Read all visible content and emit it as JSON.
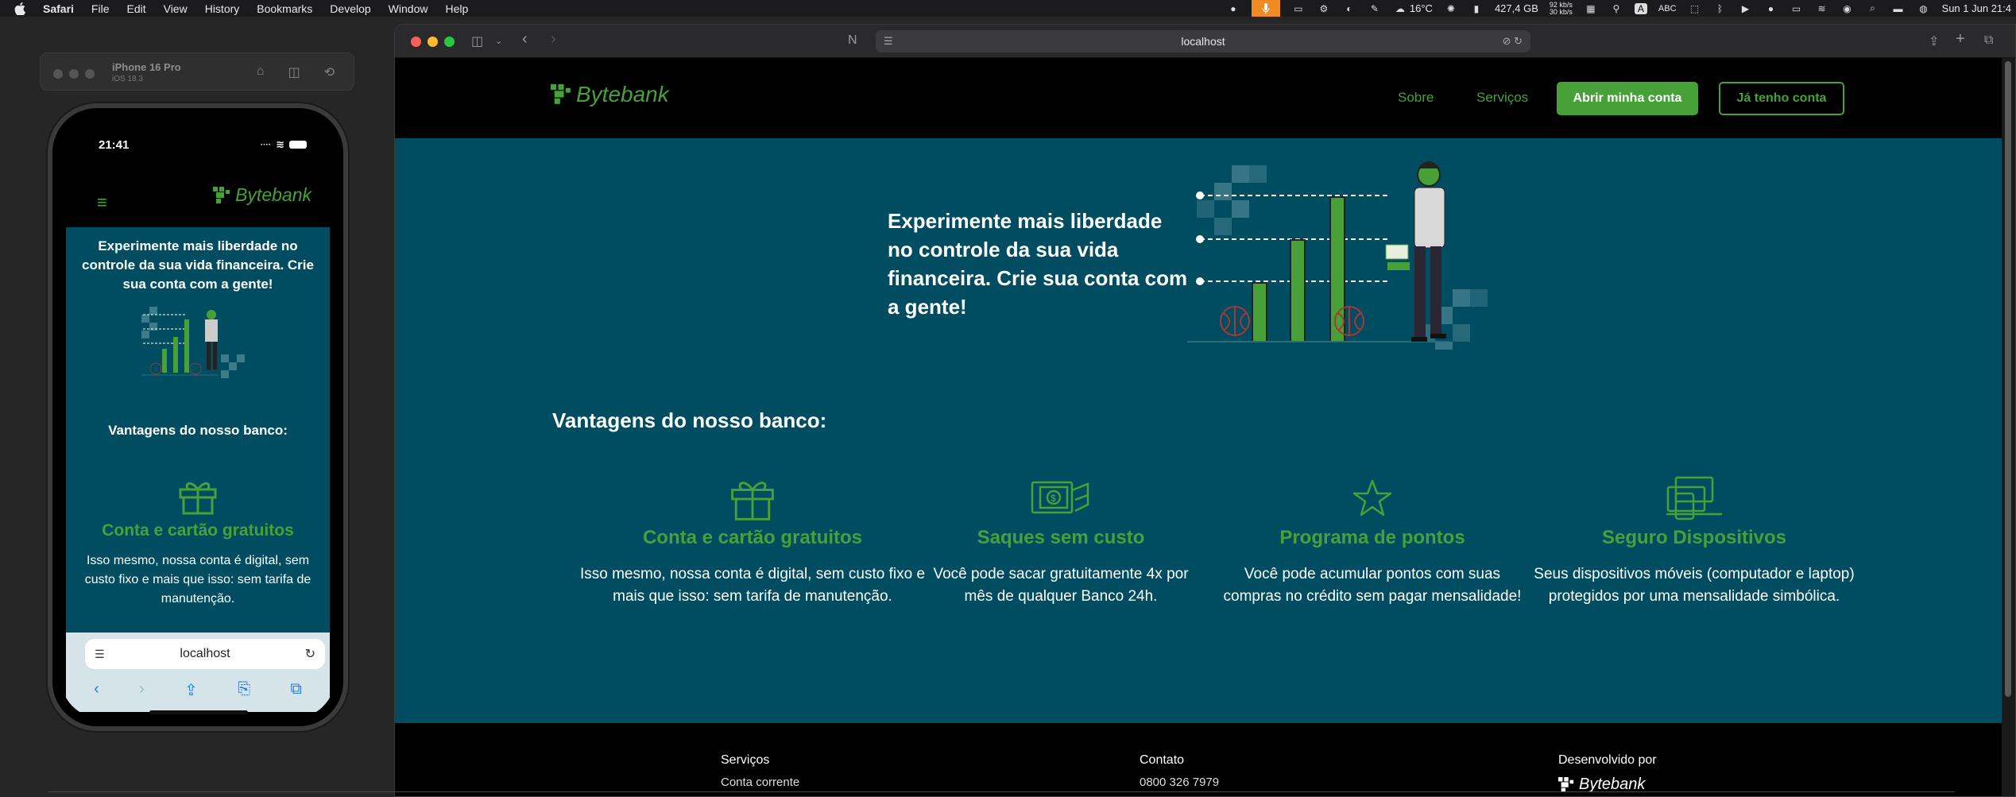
{
  "menubar": {
    "app": "Safari",
    "items": [
      "File",
      "Edit",
      "View",
      "History",
      "Bookmarks",
      "Develop",
      "Window",
      "Help"
    ],
    "weather": "16°C",
    "disk": "427,4 GB",
    "net_up": "92 kb/s",
    "net_down": "30 kb/s",
    "input_source": "ABC",
    "datetime": "Sun 1 Jun 21:4"
  },
  "simulator": {
    "device": "iPhone 16 Pro",
    "os": "iOS 18.3",
    "time": "21:41"
  },
  "phone_page": {
    "logo": "Bytebank",
    "hero": "Experimente mais liberdade no controle da sua vida financeira. Crie sua conta com a gente!",
    "advantages_title": "Vantagens do nosso banco:",
    "card_title": "Conta e cartão gratuitos",
    "card_text": "Isso mesmo, nossa conta é digital, sem custo fixo e mais que isso: sem tarifa de manutenção.",
    "url": "localhost"
  },
  "browser": {
    "url": "localhost"
  },
  "site": {
    "logo": "Bytebank",
    "nav": {
      "about": "Sobre",
      "services": "Serviços",
      "open_account": "Abrir minha conta",
      "have_account": "Já tenho conta"
    },
    "hero": "Experimente mais liberdade no controle da sua vida financeira. Crie sua conta com a gente!",
    "advantages_title": "Vantagens do nosso banco:",
    "cards": [
      {
        "icon": "gift-icon",
        "title": "Conta e cartão gratuitos",
        "text": "Isso mesmo, nossa conta é digital, sem custo fixo e mais que isso: sem tarifa de manutenção."
      },
      {
        "icon": "cash-withdrawal-icon",
        "title": "Saques sem custo",
        "text": "Você pode sacar gratuitamente 4x por mês de qualquer Banco 24h."
      },
      {
        "icon": "star-icon",
        "title": "Programa de pontos",
        "text": "Você pode acumular pontos com suas compras no crédito sem pagar mensalidade!"
      },
      {
        "icon": "devices-icon",
        "title": "Seguro Dispositivos",
        "text": "Seus dispositivos móveis (computador e laptop) protegidos por uma mensalidade simbólica."
      }
    ],
    "footer": {
      "services": "Serviços",
      "services_first": "Conta corrente",
      "contact": "Contato",
      "contact_first": "0800 326 7979",
      "developed_by": "Desenvolvido por",
      "developed_logo": "Bytebank"
    }
  },
  "colors": {
    "brand_green": "#47a138",
    "brand_teal": "#004d61",
    "black": "#000000"
  }
}
